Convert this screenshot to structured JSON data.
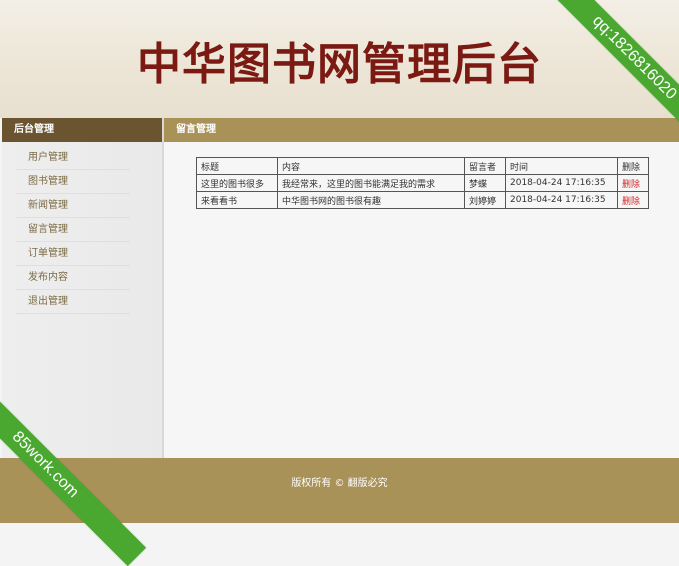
{
  "header": {
    "title": "中华图书网管理后台"
  },
  "ribbons": {
    "top_right": "qq:1826816020",
    "bottom_left": "85work.com"
  },
  "sidebar": {
    "title": "后台管理",
    "items": [
      {
        "label": "用户管理"
      },
      {
        "label": "图书管理"
      },
      {
        "label": "新闻管理"
      },
      {
        "label": "留言管理"
      },
      {
        "label": "订单管理"
      },
      {
        "label": "发布内容"
      },
      {
        "label": "退出管理"
      }
    ]
  },
  "main": {
    "title": "留言管理",
    "table": {
      "headers": [
        "标题",
        "内容",
        "留言者",
        "时间",
        "删除"
      ],
      "rows": [
        {
          "title": "这里的图书很多",
          "content": "我经常来，这里的图书能满足我的需求",
          "author": "梦蝶",
          "time": "2018-04-24 17:16:35",
          "delete": "删除"
        },
        {
          "title": "来看看书",
          "content": "中华图书网的图书很有趣",
          "author": "刘婷婷",
          "time": "2018-04-24 17:16:35",
          "delete": "删除"
        }
      ]
    }
  },
  "footer": {
    "text": "版权所有 © 翻版必究"
  },
  "colors": {
    "brand_dark": "#6b5530",
    "brand": "#a89258",
    "title_red": "#7b1a12",
    "delete_red": "#d12a2a",
    "ribbon_green": "#4aa831"
  }
}
